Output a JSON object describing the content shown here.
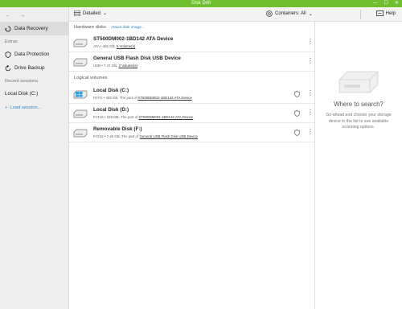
{
  "window": {
    "title": "Disk Drill",
    "minimize": "—",
    "maximize": "☐",
    "close": "✕"
  },
  "nav": {
    "back": "←",
    "forward": "→"
  },
  "sidebar": {
    "items": [
      {
        "label": "Data Recovery",
        "icon": "recovery-icon",
        "active": true
      }
    ],
    "extras_label": "Extras",
    "extras": [
      {
        "label": "Data Protection",
        "icon": "shield-icon"
      },
      {
        "label": "Drive Backup",
        "icon": "backup-icon"
      }
    ],
    "recent_label": "Recent sessions",
    "recent": [
      {
        "label": "Local Disk (C:)"
      }
    ],
    "load_session": "Load session..."
  },
  "toolbar": {
    "view_label": "Detailed",
    "containers_label": "Containers: All",
    "help_label": "Help"
  },
  "main": {
    "hardware_header": "Hardware disks",
    "attach_link": "Attach disk image...",
    "hardware": [
      {
        "name": "ST500DM002-1BD142 ATA Device",
        "sub": "ATA • 465 GB, ",
        "vol": "5 Volume(s)"
      },
      {
        "name": "General USB Flash Disk USB Device",
        "sub": "USB • 7.47 GB, ",
        "vol": "2 Volume(s)"
      }
    ],
    "logical_header": "Logical volumes",
    "logical": [
      {
        "name": "Local Disk (C:)",
        "sub": "NTFS • 465 GB. The part of ",
        "part": "ST500DM002-1BD142 ATA Device",
        "icon": "windows-disk-icon"
      },
      {
        "name": "Local Disk (D:)",
        "sub": "FAT16 • 228 MB. The part of ",
        "part": "ST500DM002-1BD142 ATA Device",
        "icon": "disk-icon"
      },
      {
        "name": "Removable Disk (F:)",
        "sub": "FAT32 • 7.46 GB. The part of ",
        "part": "General USB Flash Disk USB Device",
        "icon": "disk-icon"
      }
    ]
  },
  "right": {
    "title": "Where to search?",
    "desc": "Go ahead and choose your storage device in the list to see available scanning options."
  },
  "colors": {
    "titlebar": "#6fbf2f",
    "link": "#2a87c8"
  }
}
